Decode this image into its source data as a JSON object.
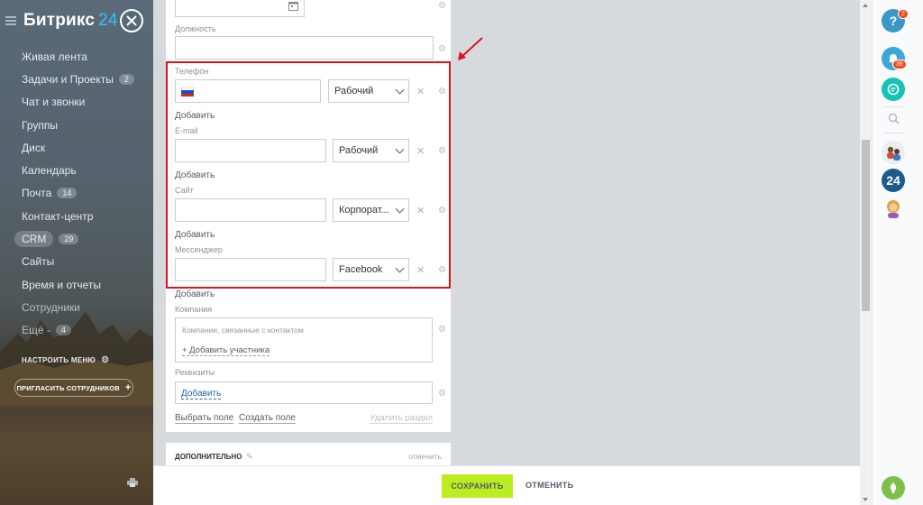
{
  "sidebar": {
    "logo_name": "Битрикс",
    "logo_num": "24",
    "items": [
      {
        "label": "Живая лента"
      },
      {
        "label": "Задачи и Проекты",
        "count": "2"
      },
      {
        "label": "Чат и звонки"
      },
      {
        "label": "Группы"
      },
      {
        "label": "Диск"
      },
      {
        "label": "Календарь"
      },
      {
        "label": "Почта",
        "count": "14"
      },
      {
        "label": "Контакт-центр"
      },
      {
        "label": "CRM",
        "count": "29"
      },
      {
        "label": "Сайты"
      },
      {
        "label": "Время и отчеты"
      },
      {
        "label": "Сотрудники"
      },
      {
        "label": "Ещё -",
        "count": "4"
      }
    ],
    "setup_label": "НАСТРОИТЬ МЕНЮ",
    "invite_label": "ПРИГЛАСИТЬ СОТРУДНИКОВ"
  },
  "form": {
    "position_label": "Должность",
    "phone_label": "Телефон",
    "phone_type": "Рабочий",
    "add_label": "Добавить",
    "email_label": "E-mail",
    "email_type": "Рабочий",
    "site_label": "Сайт",
    "site_type": "Корпорат...",
    "messenger_label": "Мессенджер",
    "messenger_type": "Facebook",
    "company_label": "Компания",
    "company_placeholder": "Компании, связанные с контактом",
    "add_participant": "+ Добавить участника",
    "requisites_label": "Реквизиты",
    "requisites_add": "Добавить",
    "select_field": "Выбрать поле",
    "create_field": "Создать поле",
    "delete_section": "Удалить раздел"
  },
  "additional": {
    "title": "ДОПОЛНИТЕЛЬНО",
    "cancel": "отменить"
  },
  "footer": {
    "save": "СОХРАНИТЬ",
    "cancel": "ОТМЕНИТЬ"
  },
  "right_panel": {
    "help_badge": "2",
    "notif_badge": "36",
    "b24_label": "24"
  },
  "colors": {
    "accent_green": "#bbed21",
    "highlight_red": "#e0121b",
    "link_blue": "#2067b0",
    "b24_blue": "#2fc6f6"
  }
}
